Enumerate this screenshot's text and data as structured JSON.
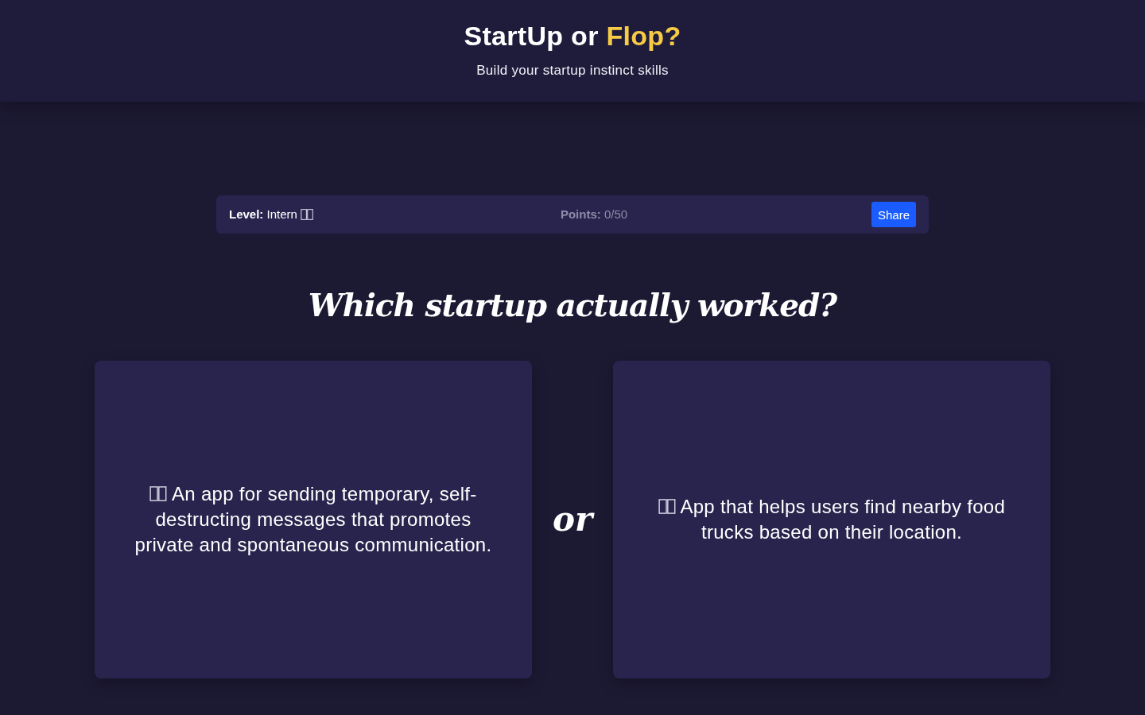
{
  "header": {
    "title": "StartUp or",
    "title_highlight": "Flop?",
    "subtitle": "Build your startup instinct skills"
  },
  "stats": {
    "level": "**Level:** Intern",
    "points": "**Points:** 0/50",
    "share_button": "Share"
  },
  "question": "Which startup actually worked?",
  "choices": [
    {
      "text": "An app for sending temporary, self-destructing messages that promotes private and spontaneous communication."
    },
    {
      "text": "App that helps users find nearby food trucks based on their location."
    }
  ],
  "separator": "or"
}
